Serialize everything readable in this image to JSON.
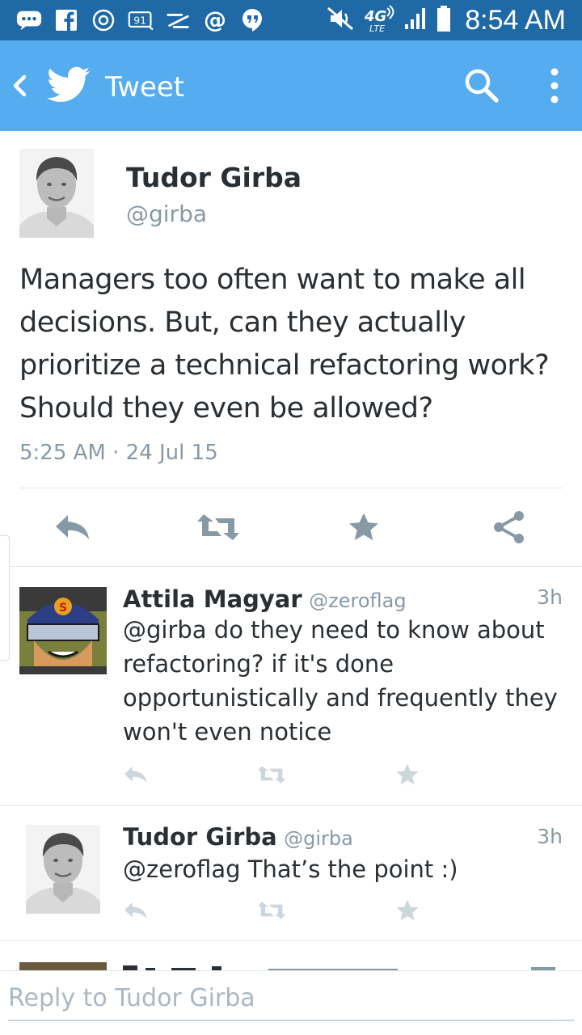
{
  "status_bar": {
    "time": "8:54 AM",
    "notification_icons": [
      "message-icon",
      "facebook-icon",
      "instagram-icon",
      "calendar-icon",
      "swipe-icon",
      "at-icon",
      "hangouts-icon"
    ],
    "network": "4G LTE"
  },
  "app_bar": {
    "title": "Tweet",
    "colors": {
      "background": "#55acee",
      "status_bar": "#1f6aa6"
    }
  },
  "tweet": {
    "name": "Tudor Girba",
    "handle": "@girba",
    "text": "Managers too often want to make all decisions. But, can they actually prioritize a technical refactoring work? Should they even be allowed?",
    "timestamp": "5:25 AM · 24 Jul 15"
  },
  "replies": [
    {
      "name": "Attila Magyar",
      "handle": "@zeroflag",
      "time": "3h",
      "text": "@girba do they need to know about refactoring? if it's done opportunistically and frequently they won't even notice"
    },
    {
      "name": "Tudor Girba",
      "handle": "@girba",
      "time": "3h",
      "text": "@zeroflag That’s the point :)"
    }
  ],
  "composer": {
    "placeholder": "Reply to Tudor Girba"
  }
}
